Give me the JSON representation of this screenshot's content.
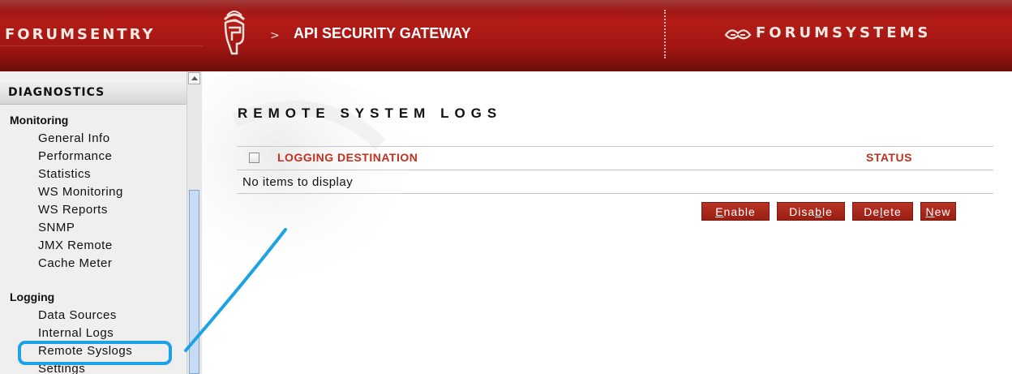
{
  "header": {
    "brand_left": "FORUMSENTRY",
    "product_title": "API SECURITY GATEWAY",
    "brand_right": "FORUMSYSTEMS",
    "helmet_icon": "helmet-logo-icon",
    "brand_right_icon": "forumsystems-logo-icon"
  },
  "sidebar": {
    "section_title": "DIAGNOSTICS",
    "groups": [
      {
        "label": "Monitoring",
        "items": [
          "General Info",
          "Performance",
          "Statistics",
          "WS Monitoring",
          "WS Reports",
          "SNMP",
          "JMX Remote",
          "Cache Meter"
        ]
      },
      {
        "label": "Logging",
        "items": [
          "Data Sources",
          "Internal Logs",
          "Remote Syslogs",
          "Settings"
        ]
      }
    ]
  },
  "main": {
    "page_title": "REMOTE SYSTEM LOGS",
    "columns": [
      "LOGGING DESTINATION",
      "STATUS"
    ],
    "empty_message": "No items to display",
    "buttons": {
      "enable": {
        "prefix": "",
        "key": "E",
        "suffix": "nable"
      },
      "disable": {
        "prefix": "Disa",
        "key": "b",
        "suffix": "le"
      },
      "delete": {
        "prefix": "De",
        "key": "l",
        "suffix": "ete"
      },
      "new": {
        "prefix": "",
        "key": "N",
        "suffix": "ew"
      }
    }
  },
  "colors": {
    "header_red": "#a31613",
    "accent_red": "#c3301e",
    "annotation_blue": "#1ea2e6"
  }
}
